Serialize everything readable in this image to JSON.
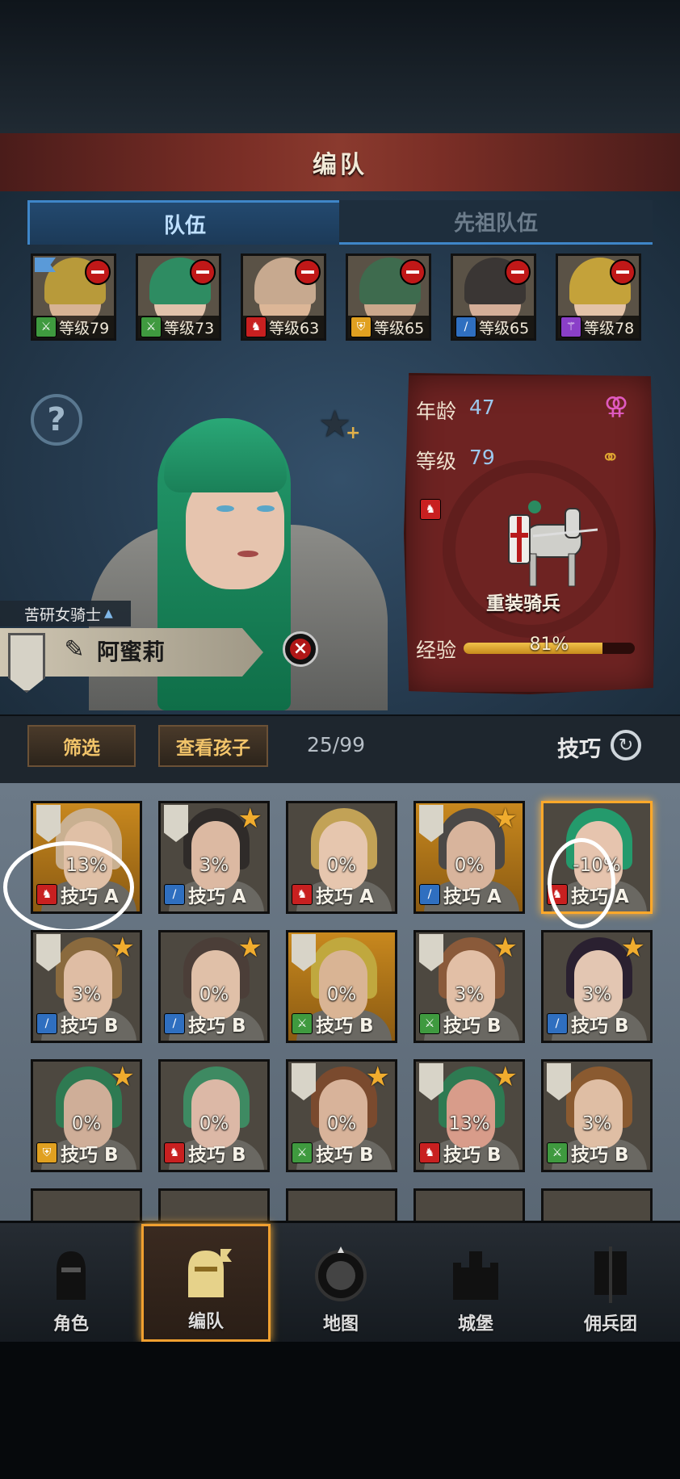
{
  "header": {
    "title": "编队"
  },
  "tabs": [
    {
      "label": "队伍",
      "active": true
    },
    {
      "label": "先祖队伍",
      "active": false
    }
  ],
  "team": [
    {
      "level_text": "等级79",
      "class_icon": "crossed-swords-icon",
      "class_color": "#3f9a3f",
      "hair": "#b89a3a",
      "skin": "#d7b394",
      "flag": true
    },
    {
      "level_text": "等级73",
      "class_icon": "crossed-swords-icon",
      "class_color": "#3f9a3f",
      "hair": "#2e8c62",
      "skin": "#e1c2ab"
    },
    {
      "level_text": "等级63",
      "class_icon": "horse-icon",
      "class_color": "#c82020",
      "hair": "#c7a98f",
      "skin": "#dcb697"
    },
    {
      "level_text": "等级65",
      "class_icon": "shield-icon",
      "class_color": "#e0a020",
      "hair": "#3e6b4e",
      "skin": "#cba88c"
    },
    {
      "level_text": "等级65",
      "class_icon": "sword-icon",
      "class_color": "#2f6fc0",
      "hair": "#3a3634",
      "skin": "#d4ae98"
    },
    {
      "level_text": "等级78",
      "class_icon": "staff-icon",
      "class_color": "#8a3fc8",
      "hair": "#c4a23a",
      "skin": "#e3c3a8"
    }
  ],
  "selected": {
    "title": "苦研女骑士",
    "name": "阿蜜莉",
    "age_label": "年龄",
    "age": "47",
    "level_label": "等级",
    "level": "79",
    "gender_icon": "female-icon",
    "status_icon": "rings-icon",
    "class_icon": "horse-icon",
    "class_name": "重装骑兵",
    "exp_label": "经验",
    "exp_text": "81%",
    "exp_percent": 81
  },
  "toolbar": {
    "filter_label": "筛选",
    "children_label": "查看孩子",
    "count": "25/99",
    "sort_label": "技巧"
  },
  "roster": [
    {
      "pct": "13%",
      "skill": "技巧 A",
      "class_icon": "horse-icon",
      "class_color": "#c82020",
      "hair": "#c9b091",
      "skin": "#e0c0a6",
      "bg": "gold",
      "banner": true,
      "star": false,
      "marked": true
    },
    {
      "pct": "3%",
      "skill": "技巧 A",
      "class_icon": "sword-icon",
      "class_color": "#2f6fc0",
      "hair": "#2f2b29",
      "skin": "#dcb9a2",
      "bg": "plain",
      "banner": true,
      "star": true
    },
    {
      "pct": "0%",
      "skill": "技巧 A",
      "class_icon": "horse-icon",
      "class_color": "#c82020",
      "hair": "#c2a256",
      "skin": "#e6c6ae",
      "bg": "plain",
      "banner": false,
      "star": false
    },
    {
      "pct": "0%",
      "skill": "技巧 A",
      "class_icon": "sword-icon",
      "class_color": "#2f6fc0",
      "hair": "#4b4846",
      "skin": "#d8b49c",
      "bg": "gold",
      "banner": true,
      "star": true
    },
    {
      "pct": "-10%",
      "skill": "技巧 A",
      "class_icon": "horse-icon",
      "class_color": "#c82020",
      "hair": "#249a6c",
      "skin": "#e6c4ae",
      "bg": "plain",
      "banner": false,
      "star": false,
      "selected": true,
      "marked": true
    },
    {
      "pct": "3%",
      "skill": "技巧 B",
      "class_icon": "sword-icon",
      "class_color": "#2f6fc0",
      "hair": "#8a6a3e",
      "skin": "#dfbda4",
      "bg": "plain",
      "banner": true,
      "star": true
    },
    {
      "pct": "0%",
      "skill": "技巧 B",
      "class_icon": "sword-icon",
      "class_color": "#2f6fc0",
      "hair": "#4b3e38",
      "skin": "#e0c0a8",
      "bg": "plain",
      "banner": false,
      "star": true
    },
    {
      "pct": "0%",
      "skill": "技巧 B",
      "class_icon": "crossed-swords-icon",
      "class_color": "#3f9a3f",
      "hair": "#c0a83e",
      "skin": "#d9b494",
      "bg": "gold",
      "banner": true,
      "star": false
    },
    {
      "pct": "3%",
      "skill": "技巧 B",
      "class_icon": "crossed-swords-icon",
      "class_color": "#3f9a3f",
      "hair": "#8a5a3a",
      "skin": "#e2bfa6",
      "bg": "plain",
      "banner": true,
      "star": true
    },
    {
      "pct": "3%",
      "skill": "技巧 B",
      "class_icon": "sword-icon",
      "class_color": "#2f6fc0",
      "hair": "#2a2030",
      "skin": "#e3c6b2",
      "bg": "plain",
      "banner": false,
      "star": true
    },
    {
      "pct": "0%",
      "skill": "技巧 B",
      "class_icon": "shield-icon",
      "class_color": "#e0a020",
      "hair": "#2e7a52",
      "skin": "#cfae98",
      "bg": "plain",
      "banner": false,
      "star": true
    },
    {
      "pct": "0%",
      "skill": "技巧 B",
      "class_icon": "horse-icon",
      "class_color": "#c82020",
      "hair": "#3e8a62",
      "skin": "#dcb8a6",
      "bg": "plain",
      "banner": false,
      "star": false
    },
    {
      "pct": "0%",
      "skill": "技巧 B",
      "class_icon": "crossed-swords-icon",
      "class_color": "#3f9a3f",
      "hair": "#7a4a2e",
      "skin": "#d8b39a",
      "bg": "plain",
      "banner": true,
      "star": true
    },
    {
      "pct": "13%",
      "skill": "技巧 B",
      "class_icon": "horse-icon",
      "class_color": "#c82020",
      "hair": "#2e7a52",
      "skin": "#d89c8a",
      "bg": "plain",
      "banner": true,
      "star": true
    },
    {
      "pct": "3%",
      "skill": "技巧 B",
      "class_icon": "crossed-swords-icon",
      "class_color": "#3f9a3f",
      "hair": "#8a5a30",
      "skin": "#dfbea4",
      "bg": "plain",
      "banner": true,
      "star": false
    }
  ],
  "nav": [
    {
      "label": "角色",
      "icon": "knight-helmet-icon",
      "active": false
    },
    {
      "label": "编队",
      "icon": "helmet-banner-icon",
      "active": true
    },
    {
      "label": "地图",
      "icon": "compass-map-icon",
      "active": false
    },
    {
      "label": "城堡",
      "icon": "castle-icon",
      "active": false
    },
    {
      "label": "佣兵团",
      "icon": "mercenary-banner-icon",
      "active": false
    }
  ]
}
